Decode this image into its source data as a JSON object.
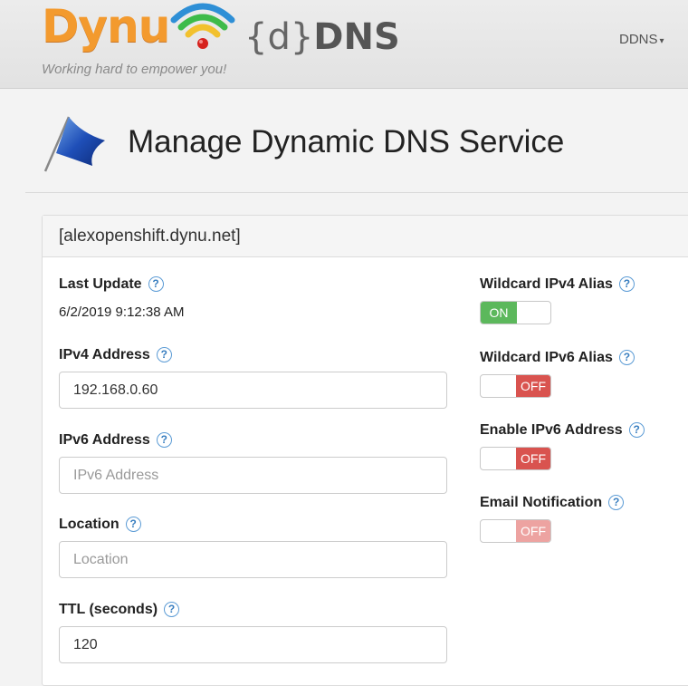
{
  "header": {
    "logo_text": "Dynu",
    "brand_open_brace": "{",
    "brand_d": "d",
    "brand_close_brace": "}",
    "brand_dns": "DNS",
    "tagline": "Working hard to empower you!",
    "nav_menu_label": "DDNS",
    "nav_caret": "▾"
  },
  "page": {
    "title": "Manage Dynamic DNS Service"
  },
  "panel": {
    "heading": "[alexopenshift.dynu.net]",
    "help_glyph": "?",
    "last_update": {
      "label": "Last Update",
      "value": "6/2/2019 9:12:38 AM"
    },
    "ipv4": {
      "label": "IPv4 Address",
      "value": "192.168.0.60",
      "placeholder": ""
    },
    "ipv6": {
      "label": "IPv6 Address",
      "value": "",
      "placeholder": "IPv6 Address"
    },
    "location": {
      "label": "Location",
      "value": "",
      "placeholder": "Location"
    },
    "ttl": {
      "label": "TTL (seconds)",
      "value": "120",
      "placeholder": ""
    },
    "toggles": [
      {
        "label": "Wildcard IPv4 Alias",
        "state_text": "ON",
        "state": "on"
      },
      {
        "label": "Wildcard IPv6 Alias",
        "state_text": "OFF",
        "state": "off"
      },
      {
        "label": "Enable IPv6 Address",
        "state_text": "OFF",
        "state": "off"
      },
      {
        "label": "Email Notification",
        "state_text": "OFF",
        "state": "off-disabled"
      }
    ]
  },
  "colors": {
    "brand_orange": "#f39a2e",
    "toggle_on": "#5cb85c",
    "toggle_off": "#d9534f",
    "toggle_off_disabled": "#eda3a1",
    "help_blue": "#3a7fc0"
  },
  "icons": {
    "logo": "wifi-signal-icon",
    "page": "flag-icon",
    "help": "help-icon",
    "nav_dropdown": "chevron-down-icon"
  }
}
